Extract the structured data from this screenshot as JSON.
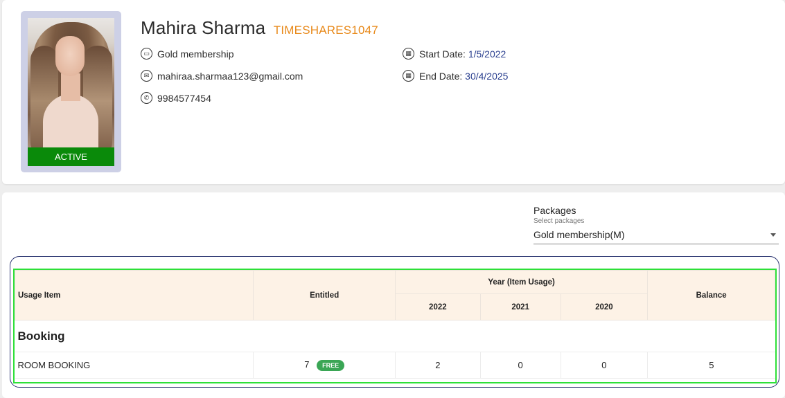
{
  "profile": {
    "name": "Mahira Sharma",
    "code": "TIMESHARES1047",
    "status": "ACTIVE",
    "membership": "Gold membership",
    "email": "mahiraa.sharmaa123@gmail.com",
    "phone": "9984577454",
    "start_label": "Start Date:",
    "start_value": "1/5/2022",
    "end_label": "End Date:",
    "end_value": "30/4/2025"
  },
  "packages": {
    "label": "Packages",
    "hint": "Select packages",
    "selected": "Gold membership(M)"
  },
  "usage_table": {
    "headers": {
      "item": "Usage Item",
      "entitled": "Entitled",
      "year_group": "Year (Item Usage)",
      "years": [
        "2022",
        "2021",
        "2020"
      ],
      "balance": "Balance"
    },
    "group": "Booking",
    "rows": [
      {
        "item": "ROOM BOOKING",
        "entitled": "7",
        "badge": "FREE",
        "y2022": "2",
        "y2021": "0",
        "y2020": "0",
        "balance": "5"
      }
    ]
  },
  "colors": {
    "status_green": "#0a8a0a",
    "code_orange": "#e8891a",
    "date_blue": "#2a3f8f",
    "header_bg": "#fdf2e6",
    "badge_green": "#3aa655"
  }
}
